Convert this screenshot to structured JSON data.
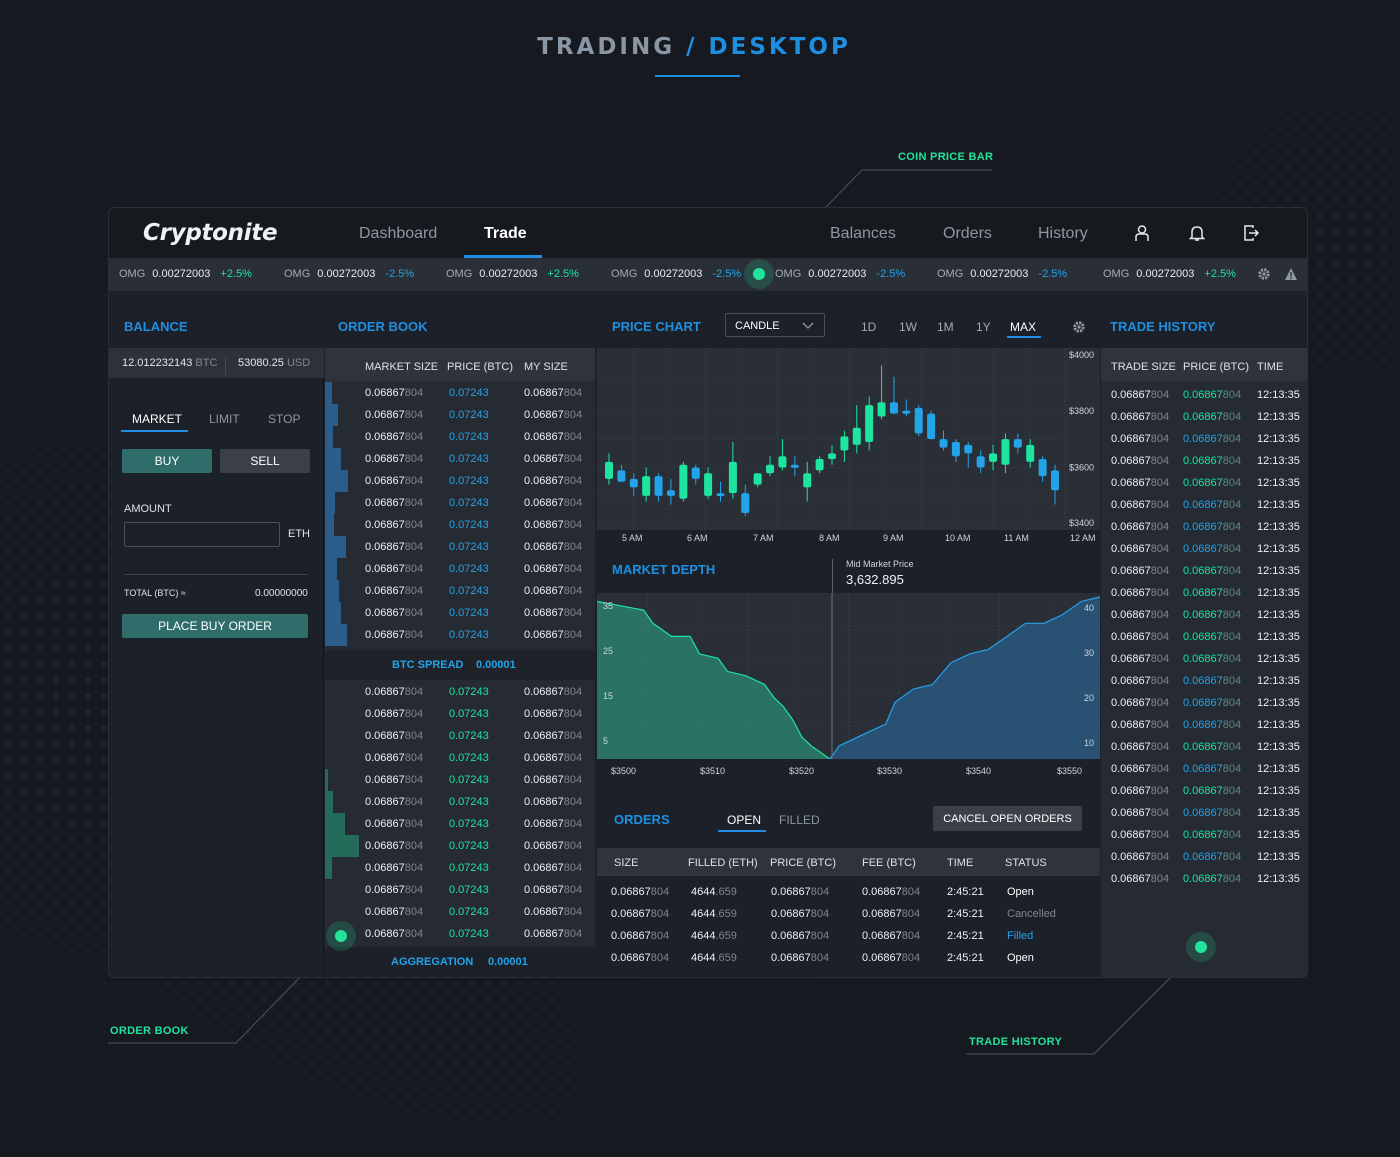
{
  "page_title": {
    "a": "TRADING",
    "sep": " / ",
    "b": "DESKTOP"
  },
  "callouts": {
    "coin_price_bar": "COIN PRICE BAR",
    "order_book": "ORDER BOOK",
    "trade_history": "TRADE HISTORY"
  },
  "app": {
    "logo": "Cryptonite",
    "nav": {
      "dashboard": "Dashboard",
      "trade": "Trade",
      "balances": "Balances",
      "orders": "Orders",
      "history": "History"
    },
    "nav_icons": [
      "user-icon",
      "bell-icon",
      "logout-icon"
    ],
    "ticker": [
      {
        "sym": "OMG",
        "val": "0.00272003",
        "chg": "+2.5%",
        "dir": "up"
      },
      {
        "sym": "OMG",
        "val": "0.00272003",
        "chg": "-2.5%",
        "dir": "down"
      },
      {
        "sym": "OMG",
        "val": "0.00272003",
        "chg": "+2.5%",
        "dir": "up"
      },
      {
        "sym": "OMG",
        "val": "0.00272003",
        "chg": "-2.5%",
        "dir": "down"
      },
      {
        "sym": "OMG",
        "val": "0.00272003",
        "chg": "-2.5%",
        "dir": "down"
      },
      {
        "sym": "OMG",
        "val": "0.00272003",
        "chg": "-2.5%",
        "dir": "down"
      },
      {
        "sym": "OMG",
        "val": "0.00272003",
        "chg": "+2.5%",
        "dir": "up"
      }
    ],
    "ticker_icons": [
      "gear-icon",
      "warning-icon"
    ],
    "balance": {
      "title": "BALANCE",
      "btc": "12.012232143",
      "btc_unit": "BTC",
      "usd": "53080.25",
      "usd_unit": "USD",
      "tabs": [
        "MARKET",
        "LIMIT",
        "STOP"
      ],
      "buy": "BUY",
      "sell": "SELL",
      "amount_label": "AMOUNT",
      "amount_value": "",
      "amount_unit": "ETH",
      "total_label": "TOTAL (BTC) ≈",
      "total_value": "0.00000000",
      "place_order": "PLACE BUY ORDER"
    },
    "order_book": {
      "title": "ORDER BOOK",
      "cols": [
        "MARKET SIZE",
        "PRICE (BTC)",
        "MY SIZE"
      ],
      "size_main": "0.06867",
      "size_dim": "804",
      "price": "0.07243",
      "spread_label": "BTC SPREAD",
      "spread_value": "0.00001",
      "agg_label": "AGGREGATION",
      "agg_value": "0.00001",
      "ask_depth": [
        0.25,
        0.5,
        0.3,
        0.6,
        0.9,
        0.4,
        0.35,
        0.8,
        0.45,
        0.55,
        0.6,
        0.85
      ],
      "bid_depth": [
        0,
        0,
        0,
        0,
        0.1,
        0.3,
        0.75,
        1.3,
        0.25,
        0,
        0,
        0
      ]
    },
    "price_chart": {
      "title": "PRICE CHART",
      "type_select": "CANDLE",
      "ranges": [
        "1D",
        "1W",
        "1M",
        "1Y",
        "MAX"
      ],
      "active_range": "MAX"
    },
    "market_depth": {
      "title": "MARKET DEPTH",
      "mid_label": "Mid Market Price",
      "mid_value": "3,632.895"
    },
    "orders": {
      "title": "ORDERS",
      "tabs": [
        "OPEN",
        "FILLED"
      ],
      "cancel": "CANCEL OPEN ORDERS",
      "cols": [
        "SIZE",
        "FILLED (ETH)",
        "PRICE (BTC)",
        "FEE (BTC)",
        "TIME",
        "STATUS"
      ],
      "rows": [
        {
          "size": "0.06867",
          "size_dim": "804",
          "filled": "4644",
          "filled_dim": ".659",
          "price": "0.06867",
          "price_dim": "804",
          "fee": "0.06867",
          "fee_dim": "804",
          "time": "2:45:21",
          "status": "Open"
        },
        {
          "size": "0.06867",
          "size_dim": "804",
          "filled": "4644",
          "filled_dim": ".659",
          "price": "0.06867",
          "price_dim": "804",
          "fee": "0.06867",
          "fee_dim": "804",
          "time": "2:45:21",
          "status": "Cancelled"
        },
        {
          "size": "0.06867",
          "size_dim": "804",
          "filled": "4644",
          "filled_dim": ".659",
          "price": "0.06867",
          "price_dim": "804",
          "fee": "0.06867",
          "fee_dim": "804",
          "time": "2:45:21",
          "status": "Filled"
        },
        {
          "size": "0.06867",
          "size_dim": "804",
          "filled": "4644",
          "filled_dim": ".659",
          "price": "0.06867",
          "price_dim": "804",
          "fee": "0.06867",
          "fee_dim": "804",
          "time": "2:45:21",
          "status": "Open"
        }
      ]
    },
    "trade_history": {
      "title": "TRADE HISTORY",
      "cols": [
        "TRADE SIZE",
        "PRICE (BTC)",
        "TIME"
      ],
      "size_main": "0.06867",
      "size_dim": "804",
      "price_main": "0.06867",
      "price_dim": "804",
      "time": "12:13:35",
      "price_dirs": [
        "up",
        "up",
        "dn",
        "up",
        "up",
        "dn",
        "dn",
        "dn",
        "up",
        "up",
        "up",
        "up",
        "up",
        "dn",
        "dn",
        "dn",
        "up",
        "dn",
        "up",
        "dn",
        "up",
        "dn",
        "up"
      ]
    },
    "colors": {
      "accent": "#1e8fe0",
      "up": "#1de5a0",
      "down": "#23a3ea",
      "callout": "#22e39b"
    }
  },
  "chart_data": [
    {
      "type": "candlestick",
      "title": "PRICE CHART",
      "x_ticks": [
        "5 AM",
        "6 AM",
        "7 AM",
        "8 AM",
        "9 AM",
        "10 AM",
        "11 AM",
        "12 AM"
      ],
      "y_ticks": [
        "$4000",
        "$3800",
        "$3600",
        "$3400"
      ],
      "ylim": [
        3380,
        4000
      ],
      "candles": [
        {
          "o": 3560,
          "h": 3650,
          "l": 3540,
          "c": 3620,
          "d": "up"
        },
        {
          "o": 3590,
          "h": 3610,
          "l": 3550,
          "c": 3550,
          "d": "down"
        },
        {
          "o": 3560,
          "h": 3580,
          "l": 3500,
          "c": 3530,
          "d": "down"
        },
        {
          "o": 3500,
          "h": 3600,
          "l": 3480,
          "c": 3570,
          "d": "up"
        },
        {
          "o": 3570,
          "h": 3580,
          "l": 3480,
          "c": 3500,
          "d": "down"
        },
        {
          "o": 3500,
          "h": 3560,
          "l": 3470,
          "c": 3520,
          "d": "down"
        },
        {
          "o": 3490,
          "h": 3620,
          "l": 3480,
          "c": 3610,
          "d": "up"
        },
        {
          "o": 3600,
          "h": 3610,
          "l": 3540,
          "c": 3560,
          "d": "down"
        },
        {
          "o": 3500,
          "h": 3600,
          "l": 3490,
          "c": 3580,
          "d": "up"
        },
        {
          "o": 3510,
          "h": 3550,
          "l": 3480,
          "c": 3500,
          "d": "down"
        },
        {
          "o": 3510,
          "h": 3690,
          "l": 3490,
          "c": 3620,
          "d": "up"
        },
        {
          "o": 3510,
          "h": 3540,
          "l": 3430,
          "c": 3440,
          "d": "down"
        },
        {
          "o": 3540,
          "h": 3580,
          "l": 3530,
          "c": 3580,
          "d": "up"
        },
        {
          "o": 3580,
          "h": 3640,
          "l": 3570,
          "c": 3610,
          "d": "up"
        },
        {
          "o": 3600,
          "h": 3700,
          "l": 3590,
          "c": 3640,
          "d": "up"
        },
        {
          "o": 3610,
          "h": 3640,
          "l": 3570,
          "c": 3600,
          "d": "down"
        },
        {
          "o": 3580,
          "h": 3620,
          "l": 3480,
          "c": 3530,
          "d": "up"
        },
        {
          "o": 3590,
          "h": 3640,
          "l": 3580,
          "c": 3630,
          "d": "up"
        },
        {
          "o": 3630,
          "h": 3680,
          "l": 3610,
          "c": 3650,
          "d": "up"
        },
        {
          "o": 3660,
          "h": 3730,
          "l": 3620,
          "c": 3710,
          "d": "up"
        },
        {
          "o": 3680,
          "h": 3820,
          "l": 3650,
          "c": 3740,
          "d": "up"
        },
        {
          "o": 3690,
          "h": 3850,
          "l": 3660,
          "c": 3820,
          "d": "up"
        },
        {
          "o": 3780,
          "h": 3960,
          "l": 3770,
          "c": 3830,
          "d": "up"
        },
        {
          "o": 3830,
          "h": 3920,
          "l": 3790,
          "c": 3790,
          "d": "down"
        },
        {
          "o": 3790,
          "h": 3840,
          "l": 3780,
          "c": 3800,
          "d": "down"
        },
        {
          "o": 3810,
          "h": 3820,
          "l": 3710,
          "c": 3720,
          "d": "down"
        },
        {
          "o": 3790,
          "h": 3800,
          "l": 3700,
          "c": 3700,
          "d": "down"
        },
        {
          "o": 3700,
          "h": 3730,
          "l": 3660,
          "c": 3670,
          "d": "down"
        },
        {
          "o": 3690,
          "h": 3700,
          "l": 3620,
          "c": 3640,
          "d": "down"
        },
        {
          "o": 3680,
          "h": 3690,
          "l": 3600,
          "c": 3650,
          "d": "down"
        },
        {
          "o": 3640,
          "h": 3660,
          "l": 3580,
          "c": 3600,
          "d": "down"
        },
        {
          "o": 3620,
          "h": 3680,
          "l": 3590,
          "c": 3650,
          "d": "up"
        },
        {
          "o": 3610,
          "h": 3720,
          "l": 3580,
          "c": 3700,
          "d": "up"
        },
        {
          "o": 3700,
          "h": 3720,
          "l": 3650,
          "c": 3670,
          "d": "down"
        },
        {
          "o": 3680,
          "h": 3700,
          "l": 3600,
          "c": 3620,
          "d": "up"
        },
        {
          "o": 3630,
          "h": 3640,
          "l": 3550,
          "c": 3570,
          "d": "down"
        },
        {
          "o": 3590,
          "h": 3610,
          "l": 3470,
          "c": 3520,
          "d": "down"
        }
      ]
    },
    {
      "type": "area",
      "title": "MARKET DEPTH",
      "x_ticks": [
        "$3500",
        "$3510",
        "$3520",
        "$3530",
        "$3540",
        "$3550"
      ],
      "y_left_ticks": [
        "35",
        "25",
        "15",
        "5"
      ],
      "y_right_ticks": [
        "40",
        "30",
        "20",
        "10"
      ],
      "xlim": [
        3498,
        3552
      ],
      "ylim": [
        0,
        37
      ],
      "series": [
        {
          "side": "bids",
          "points": [
            [
              3498,
              36
            ],
            [
              3503,
              34
            ],
            [
              3504,
              31
            ],
            [
              3506,
              28
            ],
            [
              3508,
              28
            ],
            [
              3509,
              24
            ],
            [
              3511,
              23
            ],
            [
              3512,
              20
            ],
            [
              3514,
              19
            ],
            [
              3516,
              17
            ],
            [
              3517,
              14
            ],
            [
              3518,
              12
            ],
            [
              3519,
              9
            ],
            [
              3520,
              5
            ],
            [
              3521,
              3
            ],
            [
              3523,
              0
            ]
          ],
          "color": "#2a8a74"
        },
        {
          "side": "asks",
          "points": [
            [
              3523,
              0
            ],
            [
              3524,
              3
            ],
            [
              3526,
              5
            ],
            [
              3527,
              6
            ],
            [
              3529,
              8
            ],
            [
              3530,
              13
            ],
            [
              3532,
              16
            ],
            [
              3534,
              17
            ],
            [
              3536,
              22
            ],
            [
              3538,
              24
            ],
            [
              3540,
              25
            ],
            [
              3542,
              28
            ],
            [
              3544,
              31
            ],
            [
              3546,
              31
            ],
            [
              3547,
              32
            ],
            [
              3548,
              33
            ],
            [
              3550,
              36
            ],
            [
              3552,
              37
            ]
          ],
          "color": "#2a5d8a"
        }
      ],
      "mid_market_price": 3632.895
    }
  ]
}
